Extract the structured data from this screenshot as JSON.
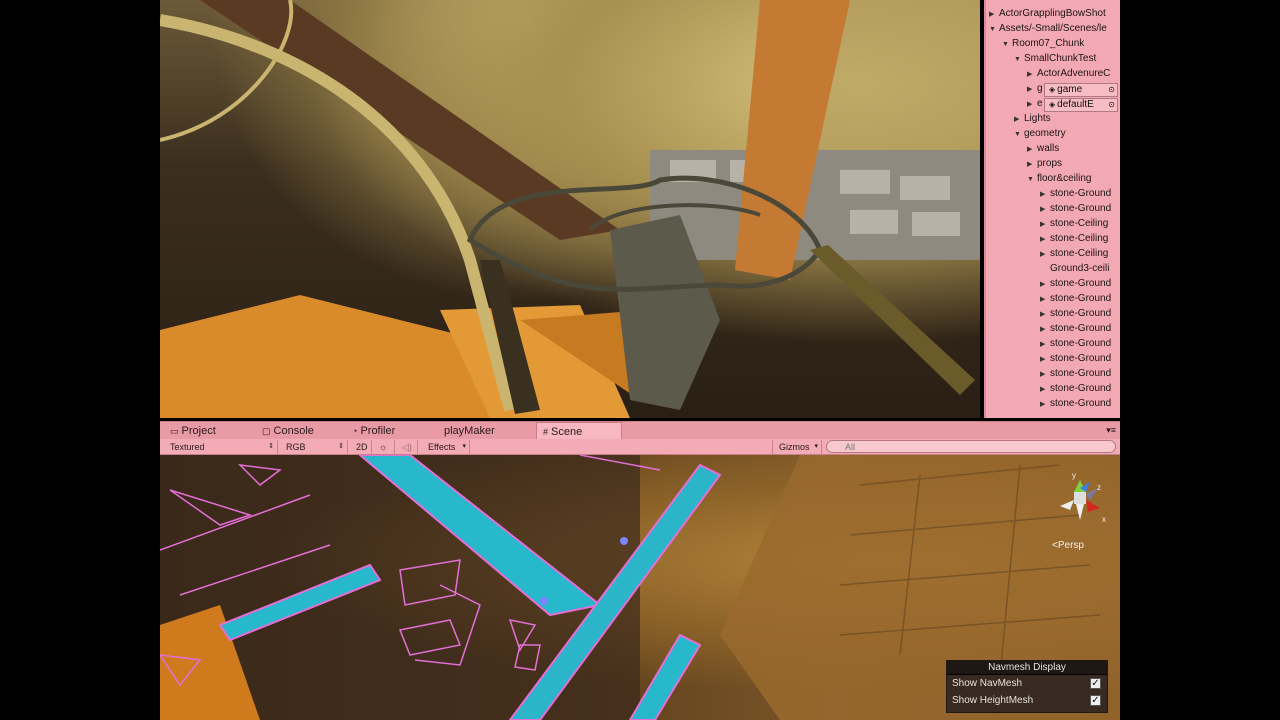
{
  "hierarchy": {
    "rows": [
      {
        "label": "ActorGrapplingBowShot",
        "arrow": "▶"
      },
      {
        "label": "Assets/-Small/Scenes/le",
        "arrow": "▼"
      },
      {
        "label": "Room07_Chunk",
        "arrow": "▼"
      },
      {
        "label": "SmallChunkTest",
        "arrow": "▼"
      },
      {
        "label": "ActorAdvenureC",
        "arrow": "▶"
      },
      {
        "label": "g",
        "arrow": "▶"
      },
      {
        "label": "e",
        "arrow": "▶"
      },
      {
        "label": "Lights",
        "arrow": "▶"
      },
      {
        "label": "geometry",
        "arrow": "▼"
      },
      {
        "label": "walls",
        "arrow": "▶"
      },
      {
        "label": "props",
        "arrow": "▶"
      },
      {
        "label": "floor&ceiling",
        "arrow": "▼"
      },
      {
        "label": "stone-Ground",
        "arrow": "▶"
      },
      {
        "label": "stone-Ground",
        "arrow": "▶"
      },
      {
        "label": "stone-Ceiling",
        "arrow": "▶"
      },
      {
        "label": "stone-Ceiling",
        "arrow": "▶"
      },
      {
        "label": "stone-Ceiling",
        "arrow": "▶"
      },
      {
        "label": "Ground3-ceili",
        "arrow": ""
      },
      {
        "label": "stone-Ground",
        "arrow": "▶"
      },
      {
        "label": "stone-Ground",
        "arrow": "▶"
      },
      {
        "label": "stone-Ground",
        "arrow": "▶"
      },
      {
        "label": "stone-Ground",
        "arrow": "▶"
      },
      {
        "label": "stone-Ground",
        "arrow": "▶"
      },
      {
        "label": "stone-Ground",
        "arrow": "▶"
      },
      {
        "label": "stone-Ground",
        "arrow": "▶"
      },
      {
        "label": "stone-Ground",
        "arrow": "▶"
      },
      {
        "label": "stone-Ground",
        "arrow": "▶"
      }
    ],
    "layer_chips": [
      "game",
      "defaultE"
    ]
  },
  "tabs": [
    {
      "label": "Project",
      "icon": "folder-icon",
      "glyph": "▭"
    },
    {
      "label": "Console",
      "icon": "console-icon",
      "glyph": "▢"
    },
    {
      "label": "Profiler",
      "icon": "profiler-icon",
      "glyph": "◔"
    },
    {
      "label": "playMaker",
      "icon": "",
      "glyph": ""
    },
    {
      "label": "Scene",
      "icon": "scene-grid-icon",
      "glyph": "#"
    }
  ],
  "scene_toolbar": {
    "draw_mode": "Textured",
    "render_mode": "RGB",
    "mode_2d": "2D",
    "effects": "Effects",
    "gizmos": "Gizmos",
    "search_placeholder": "All"
  },
  "scene_view": {
    "projection_label": "Persp",
    "gizmo_axes": {
      "y": "y",
      "z": "z",
      "x": "x"
    }
  },
  "navmesh_display": {
    "title": "Navmesh Display",
    "show_navmesh": "Show NavMesh",
    "show_heightmesh": "Show HeightMesh",
    "check_glyph": "✓"
  }
}
